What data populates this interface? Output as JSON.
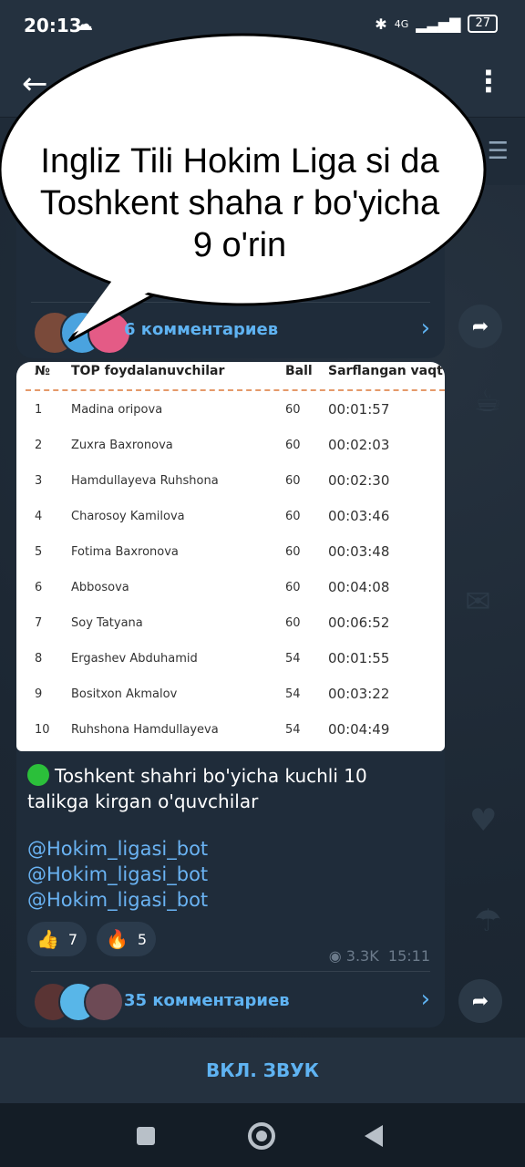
{
  "status": {
    "time": "20:13",
    "network": "4G",
    "battery": "27"
  },
  "upper_message": {
    "comments_label": "6 комментариев"
  },
  "speech_bubble": {
    "text": "Ingliz Tili Hokim Liga si da Toshkent shaha r bo'yicha 9 o'rin"
  },
  "table": {
    "headers": {
      "num": "№",
      "name": "TOP foydalanuvchilar",
      "ball": "Ball",
      "time": "Sarflangan vaqt"
    },
    "rows": [
      {
        "n": "1",
        "name": "Madina oripova",
        "ball": "60",
        "time": "00:01:57"
      },
      {
        "n": "2",
        "name": "Zuxra Baxronova",
        "ball": "60",
        "time": "00:02:03"
      },
      {
        "n": "3",
        "name": "Hamdullayeva Ruhshona",
        "ball": "60",
        "time": "00:02:30"
      },
      {
        "n": "4",
        "name": "Charosoy Kamilova",
        "ball": "60",
        "time": "00:03:46"
      },
      {
        "n": "5",
        "name": "Fotima Baxronova",
        "ball": "60",
        "time": "00:03:48"
      },
      {
        "n": "6",
        "name": "Abbosova",
        "ball": "60",
        "time": "00:04:08"
      },
      {
        "n": "7",
        "name": "Soy Tatyana",
        "ball": "60",
        "time": "00:06:52"
      },
      {
        "n": "8",
        "name": "Ergashev Abduhamid",
        "ball": "54",
        "time": "00:01:55"
      },
      {
        "n": "9",
        "name": "Bositxon Akmalov",
        "ball": "54",
        "time": "00:03:22"
      },
      {
        "n": "10",
        "name": "Ruhshona Hamdullayeva",
        "ball": "54",
        "time": "00:04:49"
      }
    ]
  },
  "post": {
    "caption": "Toshkent shahri bo'yicha kuchli 10 talikga kirgan o'quvchilar",
    "links": [
      "@Hokim_ligasi_bot",
      "@Hokim_ligasi_bot",
      "@Hokim_ligasi_bot"
    ],
    "reactions": [
      {
        "emoji": "👍",
        "count": "7"
      },
      {
        "emoji": "🔥",
        "count": "5"
      }
    ],
    "views": "3.3K",
    "time": "15:11",
    "comments_label": "35 комментариев"
  },
  "bottom": {
    "unmute_label": "ВКЛ. ЗВУК"
  },
  "colors": {
    "accent": "#5fb3f2",
    "bubble_bg": "#1f2c3a",
    "chat_bg": "#1b2633"
  }
}
